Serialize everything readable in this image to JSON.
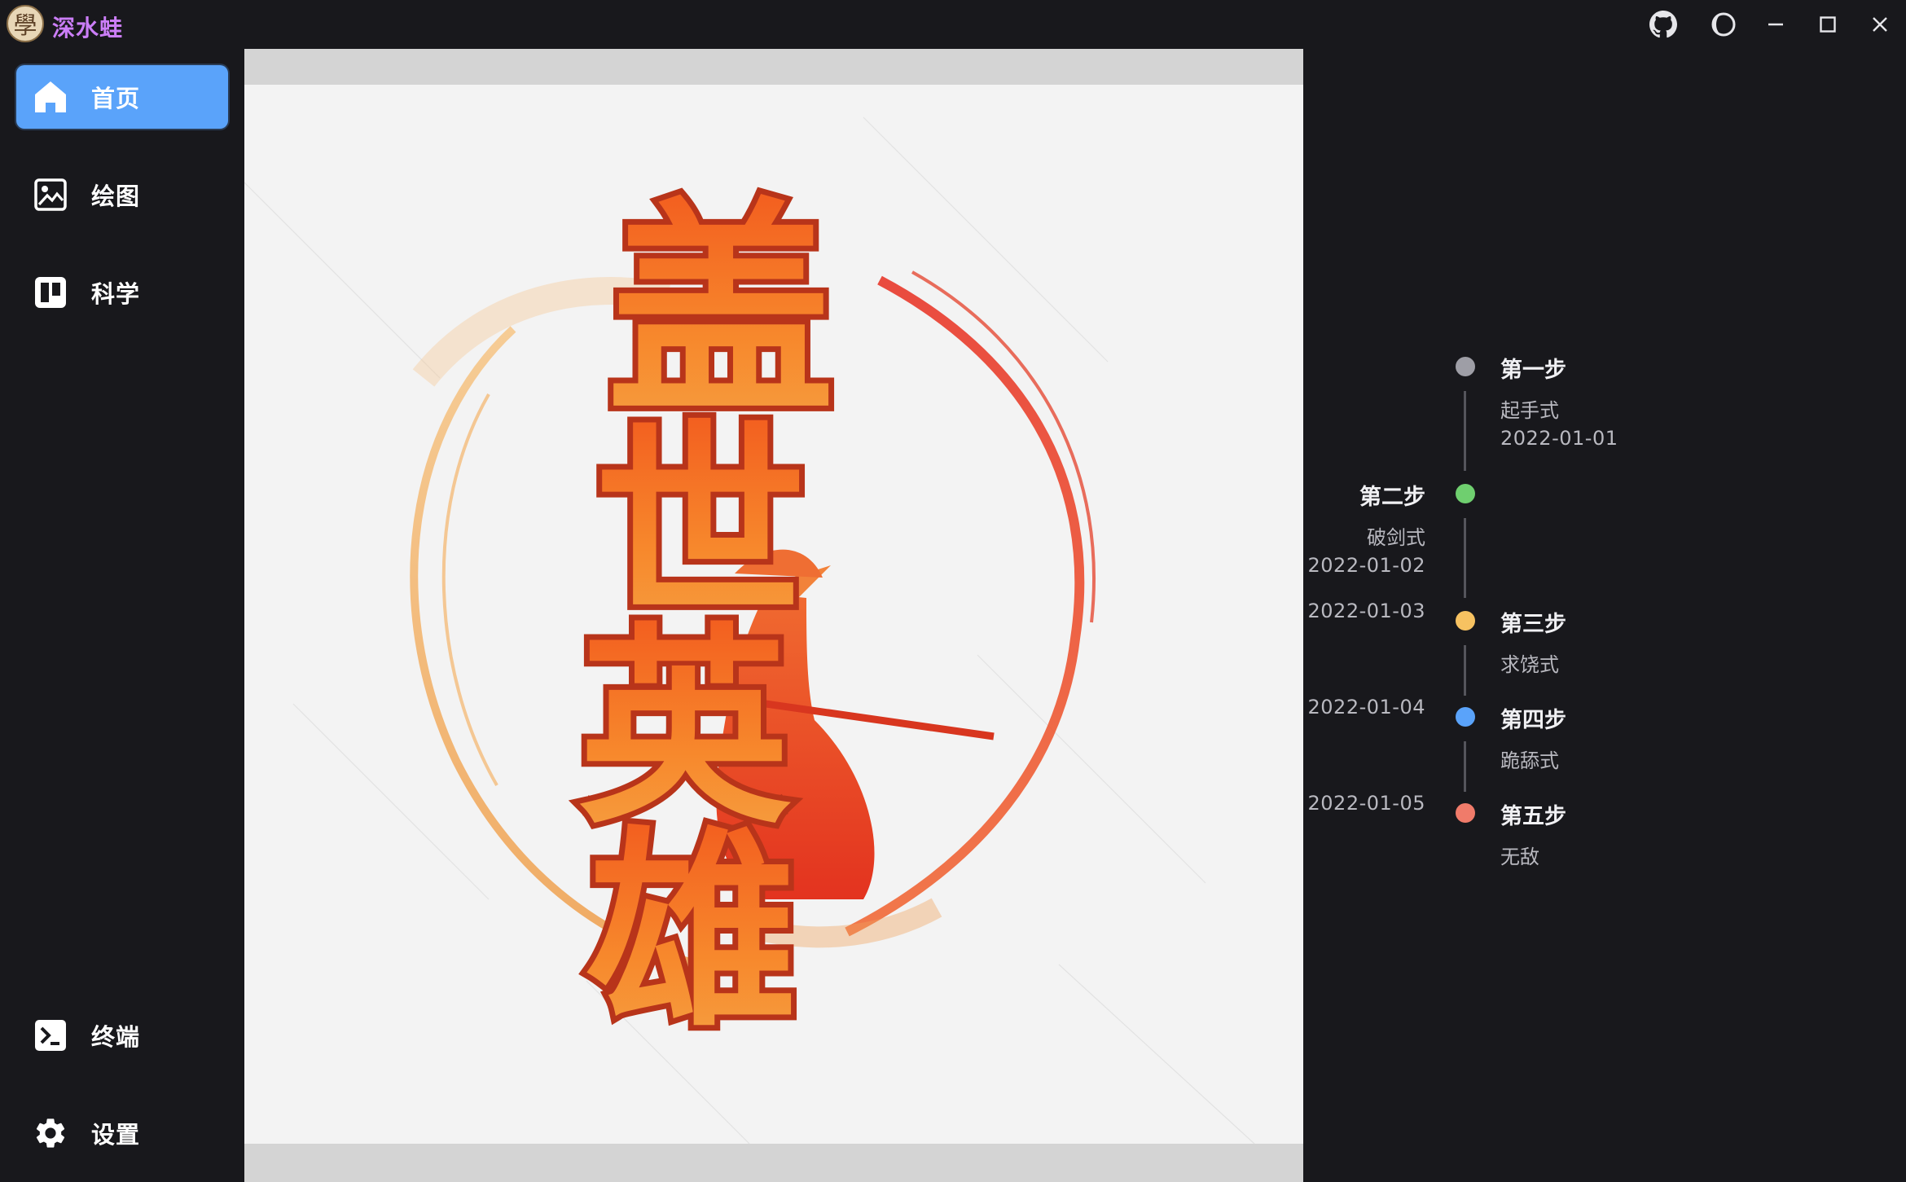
{
  "app": {
    "name": "深水蛙",
    "logo_char": "學"
  },
  "titlebar": {
    "icons": [
      "github-icon",
      "theme-moon-icon",
      "minimize-icon",
      "maximize-icon",
      "close-icon"
    ]
  },
  "sidebar": {
    "items": [
      {
        "label": "首页",
        "icon": "home-icon",
        "active": true
      },
      {
        "label": "绘图",
        "icon": "image-icon",
        "active": false
      },
      {
        "label": "科学",
        "icon": "board-icon",
        "active": false
      }
    ],
    "bottom_items": [
      {
        "label": "终端",
        "icon": "terminal-icon"
      },
      {
        "label": "设置",
        "icon": "gear-icon"
      }
    ],
    "active_color": "#5aa3fa"
  },
  "content": {
    "image": "poster-image"
  },
  "timeline": {
    "steps": [
      {
        "title": "第一步",
        "desc": "起手式",
        "date": "2022-01-01",
        "color": "#9e9ea6"
      },
      {
        "title": "第二步",
        "desc": "破剑式",
        "date": "2022-01-02",
        "color": "#6fcf6f"
      },
      {
        "title": "第三步",
        "desc": "求饶式",
        "date": "2022-01-03",
        "color": "#f7c261"
      },
      {
        "title": "第四步",
        "desc": "跪舔式",
        "date": "2022-01-04",
        "color": "#5aa3fa"
      },
      {
        "title": "第五步",
        "desc": "无敌",
        "date": "2022-01-05",
        "color": "#f07b6a"
      }
    ]
  }
}
